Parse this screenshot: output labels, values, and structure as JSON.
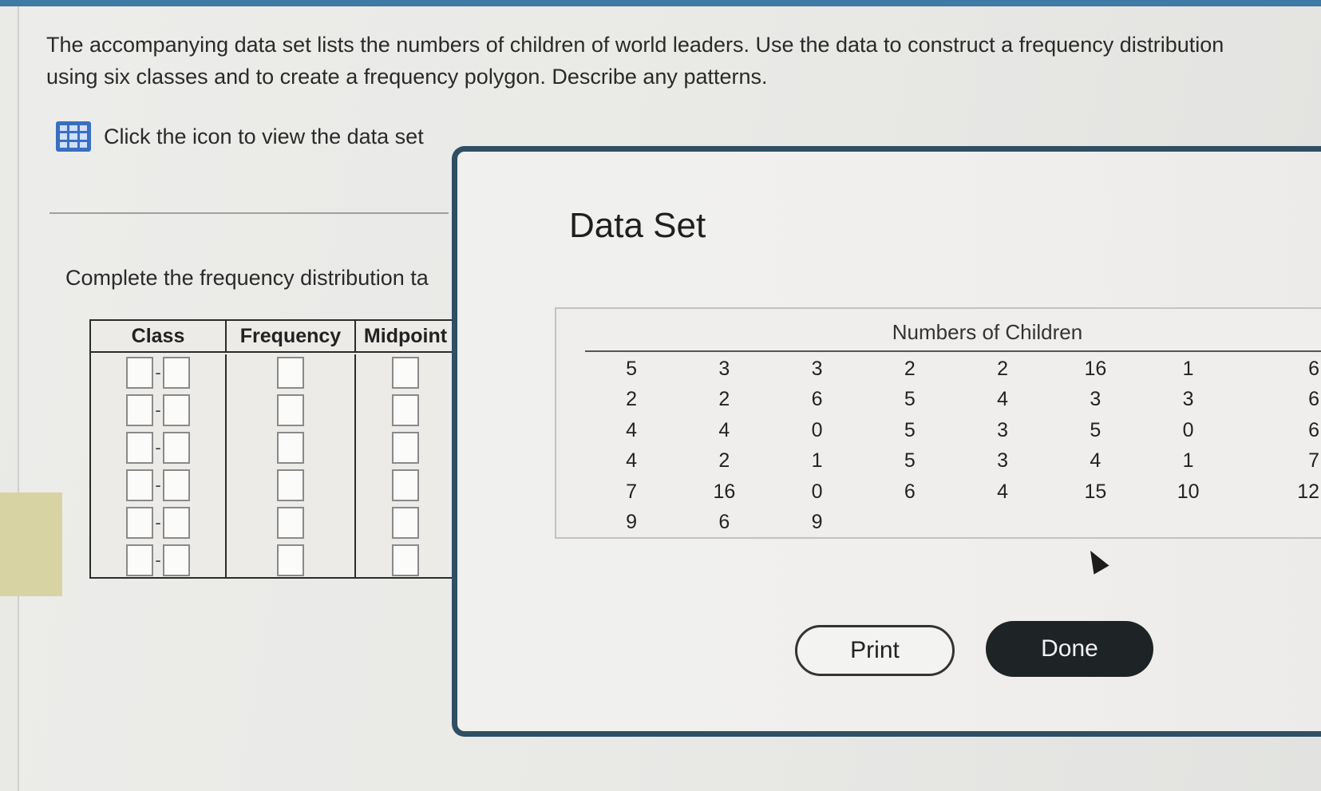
{
  "question": {
    "text": "The accompanying data set lists the numbers of children of world leaders. Use the data to construct a frequency distribution using six classes and to create a frequency polygon. Describe any patterns.",
    "dataset_link": "Click the icon to view the data set",
    "instruction": "Complete the frequency distribution ta"
  },
  "freq_table": {
    "headers": [
      "Class",
      "Frequency",
      "Midpoint"
    ],
    "row_count": 6,
    "rows": [
      {
        "class_lower": "",
        "class_upper": "",
        "frequency": "",
        "midpoint": ""
      },
      {
        "class_lower": "",
        "class_upper": "",
        "frequency": "",
        "midpoint": ""
      },
      {
        "class_lower": "",
        "class_upper": "",
        "frequency": "",
        "midpoint": ""
      },
      {
        "class_lower": "",
        "class_upper": "",
        "frequency": "",
        "midpoint": ""
      },
      {
        "class_lower": "",
        "class_upper": "",
        "frequency": "",
        "midpoint": ""
      },
      {
        "class_lower": "",
        "class_upper": "",
        "frequency": "",
        "midpoint": ""
      }
    ],
    "range_separator": "-"
  },
  "dialog": {
    "title": "Data Set",
    "table_caption": "Numbers of Children",
    "rows": [
      [
        "5",
        "3",
        "3",
        "2",
        "2",
        "16",
        "1",
        "6"
      ],
      [
        "2",
        "2",
        "6",
        "5",
        "4",
        "3",
        "3",
        "6"
      ],
      [
        "4",
        "4",
        "0",
        "5",
        "3",
        "5",
        "0",
        "6"
      ],
      [
        "4",
        "2",
        "1",
        "5",
        "3",
        "4",
        "1",
        "7"
      ],
      [
        "7",
        "16",
        "0",
        "6",
        "4",
        "15",
        "10",
        "12"
      ],
      [
        "9",
        "6",
        "9",
        "",
        "",
        "",
        "",
        ""
      ]
    ],
    "print_label": "Print",
    "done_label": "Done"
  }
}
